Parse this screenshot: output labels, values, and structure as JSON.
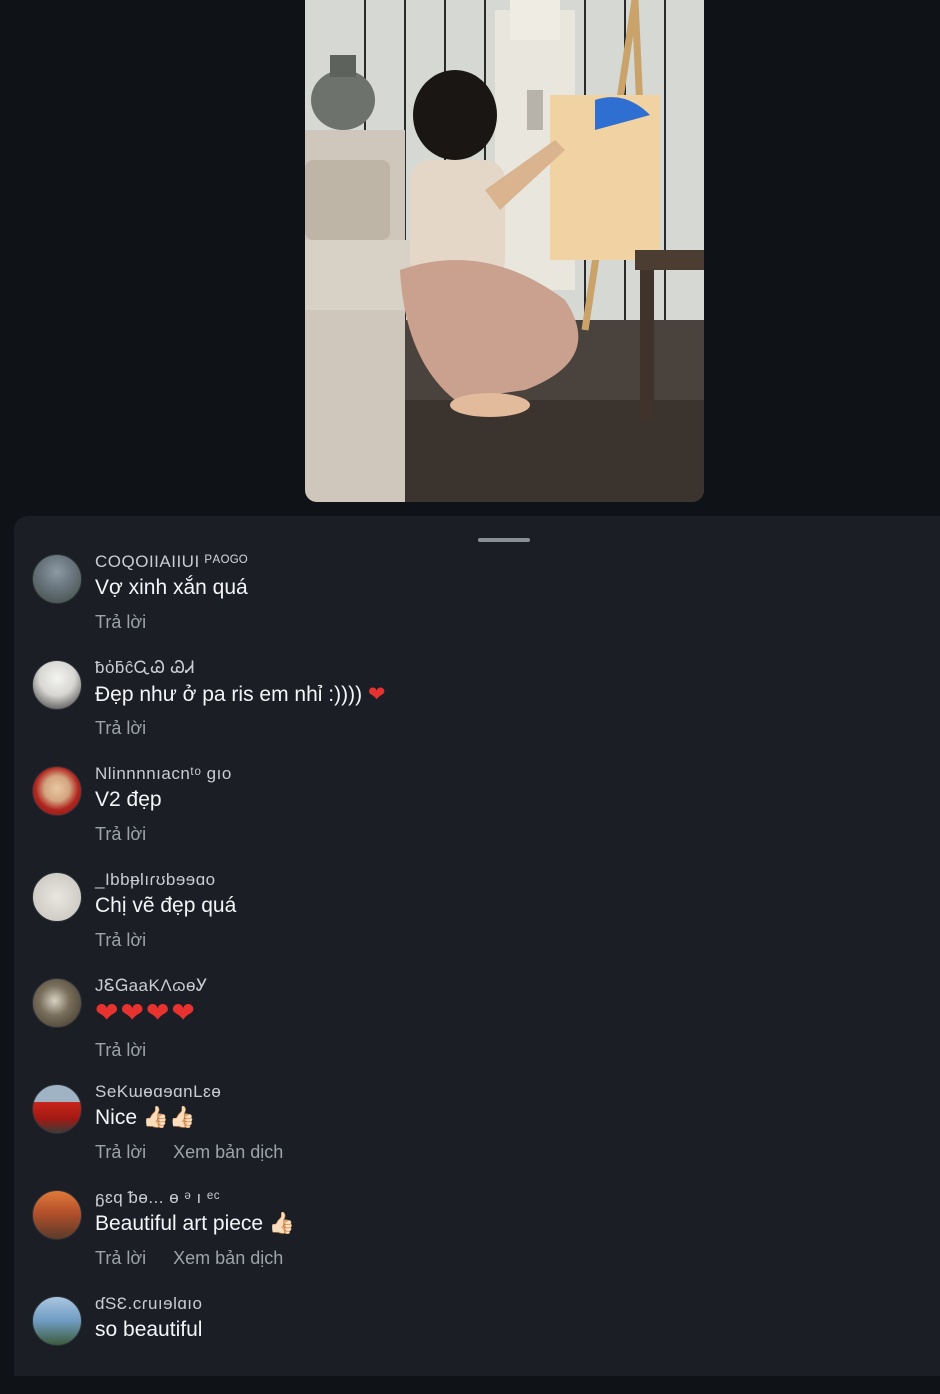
{
  "colors": {
    "background": "#0f1318",
    "sheet": "#1b1f25",
    "text_primary": "#f4f5f7",
    "text_secondary": "#9ea3aa",
    "heart": "#e8322f"
  },
  "video": {
    "icon": "video-thumbnail"
  },
  "comments": [
    {
      "username": "COQOIIAIIUI ᴾᴬᴼᴳᴼ",
      "text": "Vợ xinh xắn quá",
      "reply": "Trả lời",
      "avatar_icon": "avatar-photo"
    },
    {
      "username": "ƀὀƃĉᏩᏊ ᏊᏗ",
      "text": "Đẹp như ở pa ris em nhỉ :))))",
      "emoji": "❤",
      "reply": "Trả lời",
      "avatar_icon": "avatar-photo"
    },
    {
      "username": "Nlinnnnıacnᵗᵒ gıo",
      "text": "V2 đẹp",
      "reply": "Trả lời",
      "avatar_icon": "avatar-photo"
    },
    {
      "username": "_Ibbᵽlıɾʊbɘɘɑo",
      "text": "Chị vẽ đẹp quá",
      "reply": "Trả lời",
      "avatar_icon": "avatar-photo"
    },
    {
      "username": "JᏋᏀaaKɅɷɵᎩ",
      "text": "❤❤❤❤",
      "reply": "Trả lời",
      "avatar_icon": "avatar-photo"
    },
    {
      "username": "SeKɯɵɑɘɑnLɛɵ",
      "text": "Nice 👍🏻👍🏻",
      "reply": "Trả lời",
      "translate": "Xem bản dịch",
      "avatar_icon": "avatar-photo"
    },
    {
      "username": "ᵷɛq ᵬɵ... ɵ ᵊ ı ᵉᶜ",
      "text": "Beautiful art piece 👍🏻",
      "reply": "Trả lời",
      "translate": "Xem bản dịch",
      "avatar_icon": "avatar-photo"
    },
    {
      "username": "ɗSƐ.cɾuıɘlɑıo",
      "text": "so beautiful",
      "avatar_icon": "avatar-photo"
    }
  ]
}
